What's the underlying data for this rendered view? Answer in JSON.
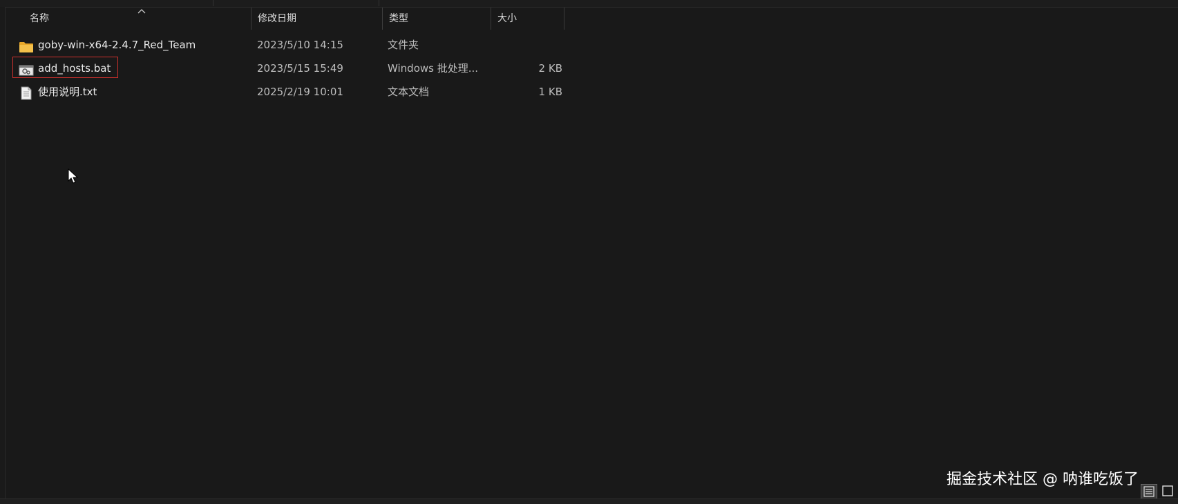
{
  "columns": {
    "name": "名称",
    "date": "修改日期",
    "type": "类型",
    "size": "大小"
  },
  "sort": {
    "column": "name",
    "icon": "sort-up-icon"
  },
  "files": [
    {
      "name": "goby-win-x64-2.4.7_Red_Team",
      "date": "2023/5/10 14:15",
      "type": "文件夹",
      "size": "",
      "icon": "folder-icon"
    },
    {
      "name": "add_hosts.bat",
      "date": "2023/5/15 15:49",
      "type": "Windows 批处理...",
      "size": "2 KB",
      "icon": "batch-file-icon",
      "highlighted": true
    },
    {
      "name": "使用说明.txt",
      "date": "2025/2/19 10:01",
      "type": "文本文档",
      "size": "1 KB",
      "icon": "text-file-icon"
    }
  ],
  "watermark": "掘金技术社区 @ 呐谁吃饭了",
  "view_modes": [
    "details-view-icon",
    "large-icons-view-icon"
  ],
  "colors": {
    "background": "#191919",
    "highlight_border": "#d0312d",
    "folder": "#f4c04a"
  }
}
